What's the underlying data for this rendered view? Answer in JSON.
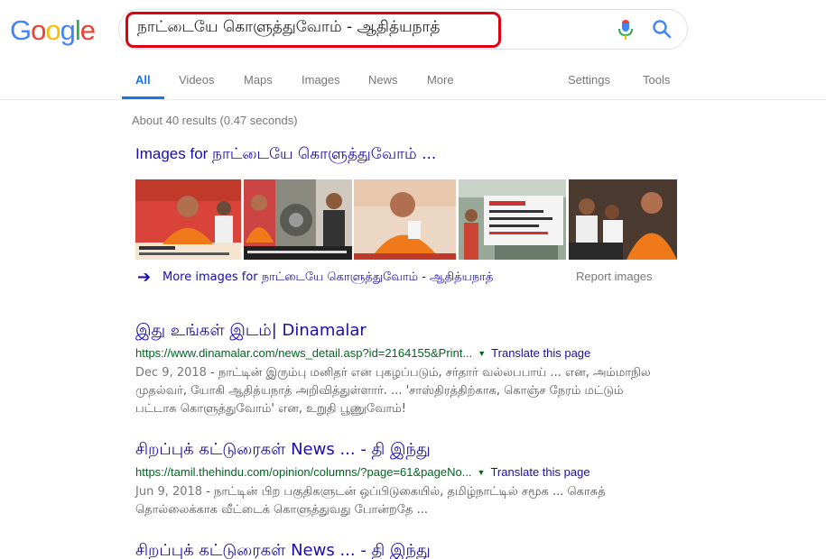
{
  "logo": {
    "letters": [
      "G",
      "o",
      "o",
      "g",
      "l",
      "e"
    ],
    "colors": [
      "#4285F4",
      "#EA4335",
      "#FBBC05",
      "#4285F4",
      "#34A853",
      "#EA4335"
    ]
  },
  "search": {
    "query": "நாட்டையே கொளுத்துவோம் - ஆதித்யநாத்",
    "highlight_color": "#e0000f"
  },
  "tabs": [
    "All",
    "Videos",
    "Maps",
    "Images",
    "News",
    "More"
  ],
  "tools": {
    "settings": "Settings",
    "tools": "Tools"
  },
  "stats": "About 40 results (0.47 seconds)",
  "images_block": {
    "heading_prefix": "Images for ",
    "heading_query": "நாட்டையே கொளுத்துவோம் ...",
    "more_images": "More images for நாட்டையே கொளுத்துவோம் - ஆதித்யநாத்",
    "report": "Report images"
  },
  "results": [
    {
      "title": "இது உங்கள் இடம்| Dinamalar",
      "url": "https://www.dinamalar.com/news_detail.asp?id=2164155&Print...",
      "translate": "Translate this page",
      "date": "Dec 9, 2018",
      "snippet": " - நாட்டின் இரும்பு மனிதர் என புகழப்படும், சர்தார் வல்லபபாய் ... என, அம்மாநில முதல்வர், யோகி ஆதித்யநாத் அறிவித்துள்ளார். ... 'சாஸ்திரத்திற்காக, கொஞ்ச நேரம் மட்டும் பட்டாசு கொளுத்துவோம்' என, உறுதி பூணுவோம்!"
    },
    {
      "title": "சிறப்புக் கட்டுரைகள் News ... - தி இந்து",
      "url": "https://tamil.thehindu.com/opinion/columns/?page=61&pageNo...",
      "translate": "Translate this page",
      "date": "Jun 9, 2018",
      "snippet": " - நாட்டின் பிற பகுதிகளுடன் ஒப்பிடுகையில், தமிழ்நாட்டில் சமூக ... கொசுத் தொல்லைக்காக வீட்டைக் கொளுத்துவது போன்றதே ..."
    },
    {
      "title": "சிறப்புக் கட்டுரைகள் News ... - தி இந்து"
    }
  ]
}
